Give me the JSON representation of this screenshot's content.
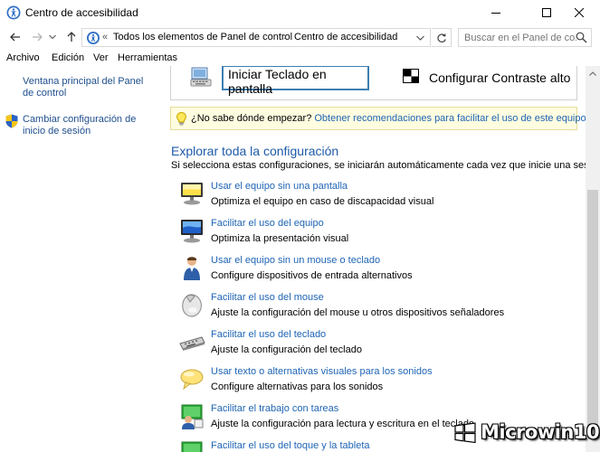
{
  "window": {
    "title": "Centro de accesibilidad",
    "icon": "accessibility-center-icon"
  },
  "address": {
    "crumbs": [
      "Todos los elementos de Panel de control",
      "Centro de accesibilidad"
    ],
    "overflow": "«",
    "separator": "›",
    "search_placeholder": "Buscar en el Panel de co..."
  },
  "menu": [
    "Archivo",
    "Edición",
    "Ver",
    "Herramientas"
  ],
  "sidebar": {
    "items": [
      {
        "label": "Ventana principal del Panel de control"
      },
      {
        "label": "Cambiar configuración de inicio de sesión",
        "icon": "shield-icon"
      }
    ]
  },
  "top_panel": {
    "keyboard_button": "Iniciar Teclado en pantalla",
    "contrast_label": "Configurar Contraste alto"
  },
  "tip": {
    "question": "¿No sabe dónde empezar?",
    "link": "Obtener recomendaciones para facilitar el uso de este equipo"
  },
  "section": {
    "title": "Explorar toda la configuración",
    "description": "Si selecciona estas configuraciones, se iniciarán automáticamente cada vez que inicie una sesión."
  },
  "items": [
    {
      "title": "Usar el equipo sin una pantalla",
      "desc": "Optimiza el equipo en caso de discapacidad visual",
      "icon": "monitor-sound-icon"
    },
    {
      "title": "Facilitar el uso del equipo",
      "desc": "Optimiza la presentación visual",
      "icon": "monitor-display-icon"
    },
    {
      "title": "Usar el equipo sin un mouse o teclado",
      "desc": "Configure dispositivos de entrada alternativos",
      "icon": "person-icon"
    },
    {
      "title": "Facilitar el uso del mouse",
      "desc": "Ajuste la configuración del mouse u otros dispositivos señaladores",
      "icon": "mouse-icon"
    },
    {
      "title": "Facilitar el uso del teclado",
      "desc": "Ajuste la configuración del teclado",
      "icon": "keyboard-icon"
    },
    {
      "title": "Usar texto o alternativas visuales para los sonidos",
      "desc": "Configure alternativas para los sonidos",
      "icon": "speech-bubble-icon"
    },
    {
      "title": "Facilitar el trabajo con tareas",
      "desc": "Ajuste la configuración para lectura y escritura en el teclado",
      "icon": "tasks-icon"
    },
    {
      "title": "Facilitar el uso del toque y la tableta",
      "desc": "",
      "icon": "touch-icon"
    }
  ],
  "watermark": {
    "text": "Microwin10"
  },
  "colors": {
    "link": "#1e64b4",
    "section_title": "#1e5aa8",
    "tip_bg": "#fffde0",
    "button_border": "#3c7fb1"
  }
}
